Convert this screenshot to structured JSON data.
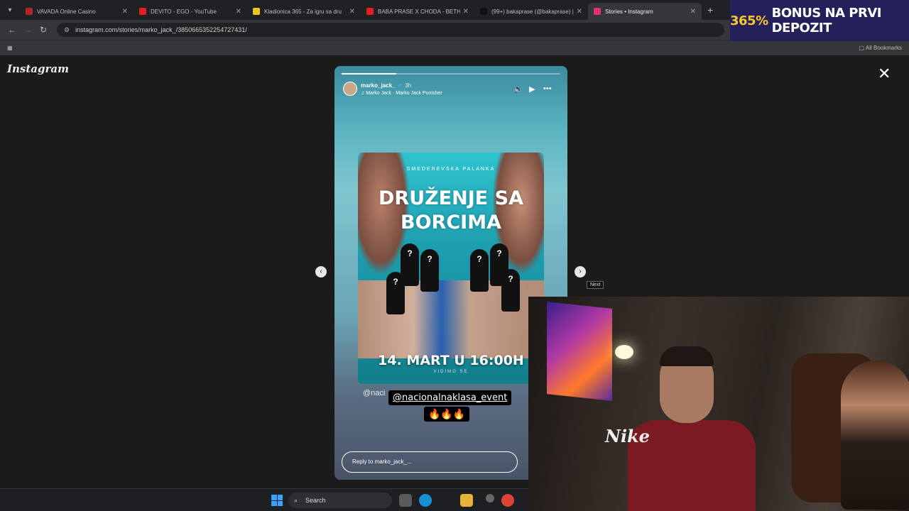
{
  "browser": {
    "tabs": [
      {
        "title": "VAVADA Online Casino",
        "color": "#b0282e"
      },
      {
        "title": "DEVITO - EGO - YouTube",
        "color": "#e02020"
      },
      {
        "title": "Kladionica 365 - Za igru sa dru",
        "color": "#f0c419"
      },
      {
        "title": "BABA PRASE X CHODA - BETH",
        "color": "#e02020"
      },
      {
        "title": "(99+) bakaprase (@bakaprase) |",
        "color": "#111111"
      },
      {
        "title": "Stories • Instagram",
        "color": "#e1306c",
        "active": true
      }
    ],
    "new_tab_label": "+",
    "url": "instagram.com/stories/marko_jack_/3850665352254727431/",
    "bookmarks_label": "All Bookmarks"
  },
  "promo": {
    "percent": "365%",
    "text": "BONUS NA PRVI DEPOZIT"
  },
  "instagram": {
    "logo": "Instagram",
    "story": {
      "username": "marko_jack_",
      "time": "3h",
      "music": "♫ Marko Jack · Marko Jack Punisher",
      "progress": 0.25,
      "poster": {
        "subtitle": "SMEDEREVSKA PALANKA",
        "title_line1": "DRUŽENJE SA",
        "title_line2": "BORCIMA",
        "date": "14. MART U 16:00H",
        "footer": "VIDIMO SE"
      },
      "mention_bg": "@naci",
      "mention": "@nacionalnaklasa_event",
      "fire": "🔥🔥🔥",
      "reply_placeholder": "Reply to marko_jack_..."
    },
    "next_tooltip": "Next"
  },
  "taskbar": {
    "search_label": "Search"
  },
  "webcam": {
    "shirt_logo": "Nike"
  }
}
